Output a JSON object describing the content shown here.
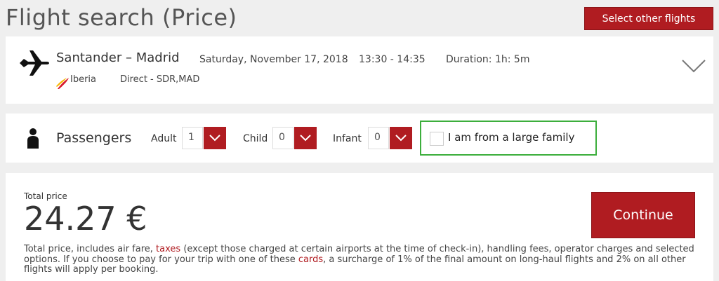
{
  "page": {
    "title": "Flight search (Price)"
  },
  "header": {
    "select_other_label": "Select other flights"
  },
  "flight": {
    "route": "Santander – Madrid",
    "date": "Saturday, November 17, 2018",
    "time": "13:30 - 14:35",
    "duration": "Duration: 1h: 5m",
    "airline": "Iberia",
    "stops": "Direct - SDR,MAD",
    "icons": {
      "plane": "airplane-icon",
      "airline_logo": "iberia-logo",
      "expand": "chevron-down-icon"
    }
  },
  "passengers": {
    "label": "Passengers",
    "adult_label": "Adult",
    "adult_value": "1",
    "child_label": "Child",
    "child_value": "0",
    "infant_label": "Infant",
    "infant_value": "0",
    "large_family_label": "I am from a large family",
    "large_family_checked": false,
    "icon": "person-icon"
  },
  "price": {
    "total_label": "Total price",
    "total_value": "24.27 €",
    "continue_label": "Continue",
    "disclaimer": {
      "part1": "Total price, includes air fare, ",
      "taxes_link": "taxes",
      "part2": " (except those charged at certain airports at the time of check-in), handling fees, operator charges and selected options. If you choose to pay for your trip with one of these ",
      "cards_link": "cards",
      "part3": ", a surcharge of 1% of the final amount on long-haul flights and 2% on all other flights will apply per booking."
    }
  },
  "colors": {
    "accent": "#b01c21",
    "highlight_border": "#3cae3c",
    "background": "#efefef",
    "panel": "#ffffff"
  }
}
